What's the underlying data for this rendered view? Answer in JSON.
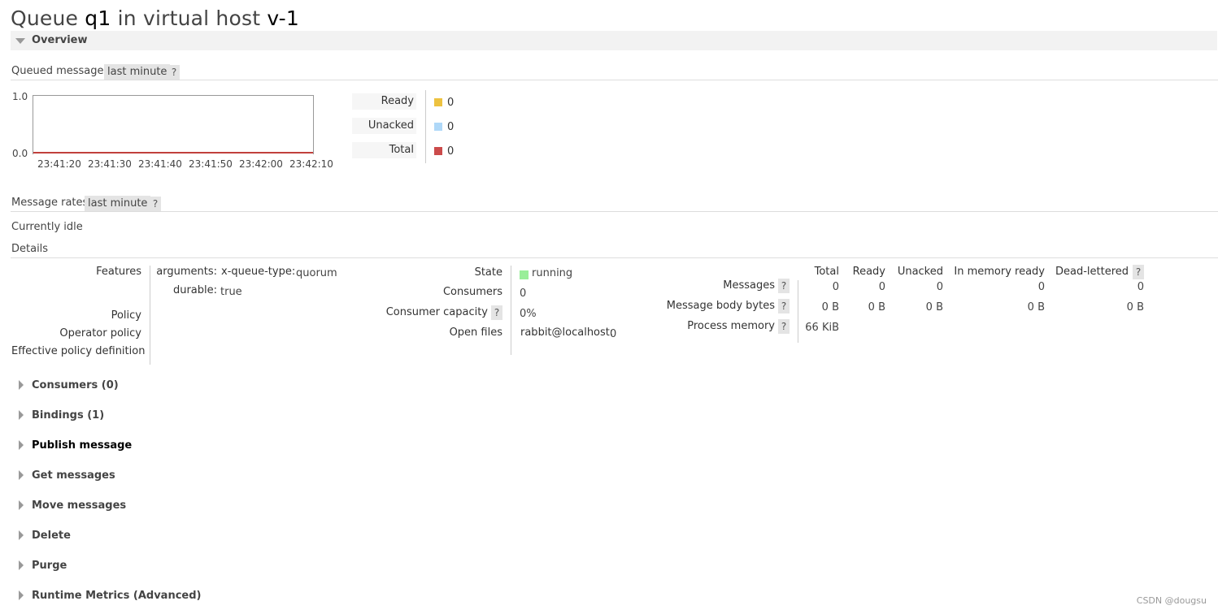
{
  "page": {
    "title_prefix": "Queue ",
    "queue_name": "q1",
    "title_mid": " in virtual host ",
    "vhost": "v-1"
  },
  "overview": {
    "label": "Overview",
    "queued_messages": {
      "label": "Queued messages",
      "range": "last minute",
      "help": "?"
    },
    "message_rates": {
      "label": "Message rates",
      "range": "last minute",
      "help": "?"
    },
    "idle_text": "Currently idle",
    "details_label": "Details"
  },
  "chart_data": {
    "type": "line",
    "x": [
      "23:41:20",
      "23:41:30",
      "23:41:40",
      "23:41:50",
      "23:42:00",
      "23:42:10"
    ],
    "y_ticks": [
      "1.0",
      "0.0"
    ],
    "ylim": [
      0,
      1
    ],
    "series": [
      {
        "name": "Ready",
        "values": [
          0,
          0,
          0,
          0,
          0,
          0
        ],
        "color": "#edc240"
      },
      {
        "name": "Unacked",
        "values": [
          0,
          0,
          0,
          0,
          0,
          0
        ],
        "color": "#afd8f8"
      },
      {
        "name": "Total",
        "values": [
          0,
          0,
          0,
          0,
          0,
          0
        ],
        "color": "#cb4b4b"
      }
    ],
    "legend": [
      {
        "label": "Ready",
        "value": "0",
        "color": "#edc240"
      },
      {
        "label": "Unacked",
        "value": "0",
        "color": "#afd8f8"
      },
      {
        "label": "Total",
        "value": "0",
        "color": "#cb4b4b"
      }
    ]
  },
  "details": {
    "features_label": "Features",
    "features": [
      {
        "key": "arguments:",
        "sub_key": "x-queue-type:",
        "value": "quorum"
      },
      {
        "key": "durable:",
        "value": "true"
      }
    ],
    "policy_label": "Policy",
    "operator_policy_label": "Operator policy",
    "effective_policy_label": "Effective policy definition",
    "state_label": "State",
    "state_value": "running",
    "state_color": "#99ee99",
    "consumers_label": "Consumers",
    "consumers_value": "0",
    "consumer_capacity_label": "Consumer capacity",
    "consumer_capacity_help": "?",
    "consumer_capacity_value": "0%",
    "open_files_label": "Open files",
    "open_files_node": "rabbit@localhost:",
    "open_files_value": "0"
  },
  "stats_table": {
    "headers": [
      "Total",
      "Ready",
      "Unacked",
      "In memory ready",
      "Dead-lettered"
    ],
    "dead_lettered_help": "?",
    "rows": [
      {
        "label": "Messages",
        "help": "?",
        "values": [
          "0",
          "0",
          "0",
          "0",
          "0"
        ]
      },
      {
        "label": "Message body bytes",
        "help": "?",
        "values": [
          "0 B",
          "0 B",
          "0 B",
          "0 B",
          "0 B"
        ]
      },
      {
        "label": "Process memory",
        "help": "?",
        "values": [
          "66 KiB"
        ]
      }
    ]
  },
  "sections": [
    {
      "label": "Consumers (0)"
    },
    {
      "label": "Bindings (1)"
    },
    {
      "label": "Publish message"
    },
    {
      "label": "Get messages"
    },
    {
      "label": "Move messages"
    },
    {
      "label": "Delete"
    },
    {
      "label": "Purge"
    },
    {
      "label": "Runtime Metrics (Advanced)"
    }
  ],
  "watermark": "CSDN @dougsu"
}
